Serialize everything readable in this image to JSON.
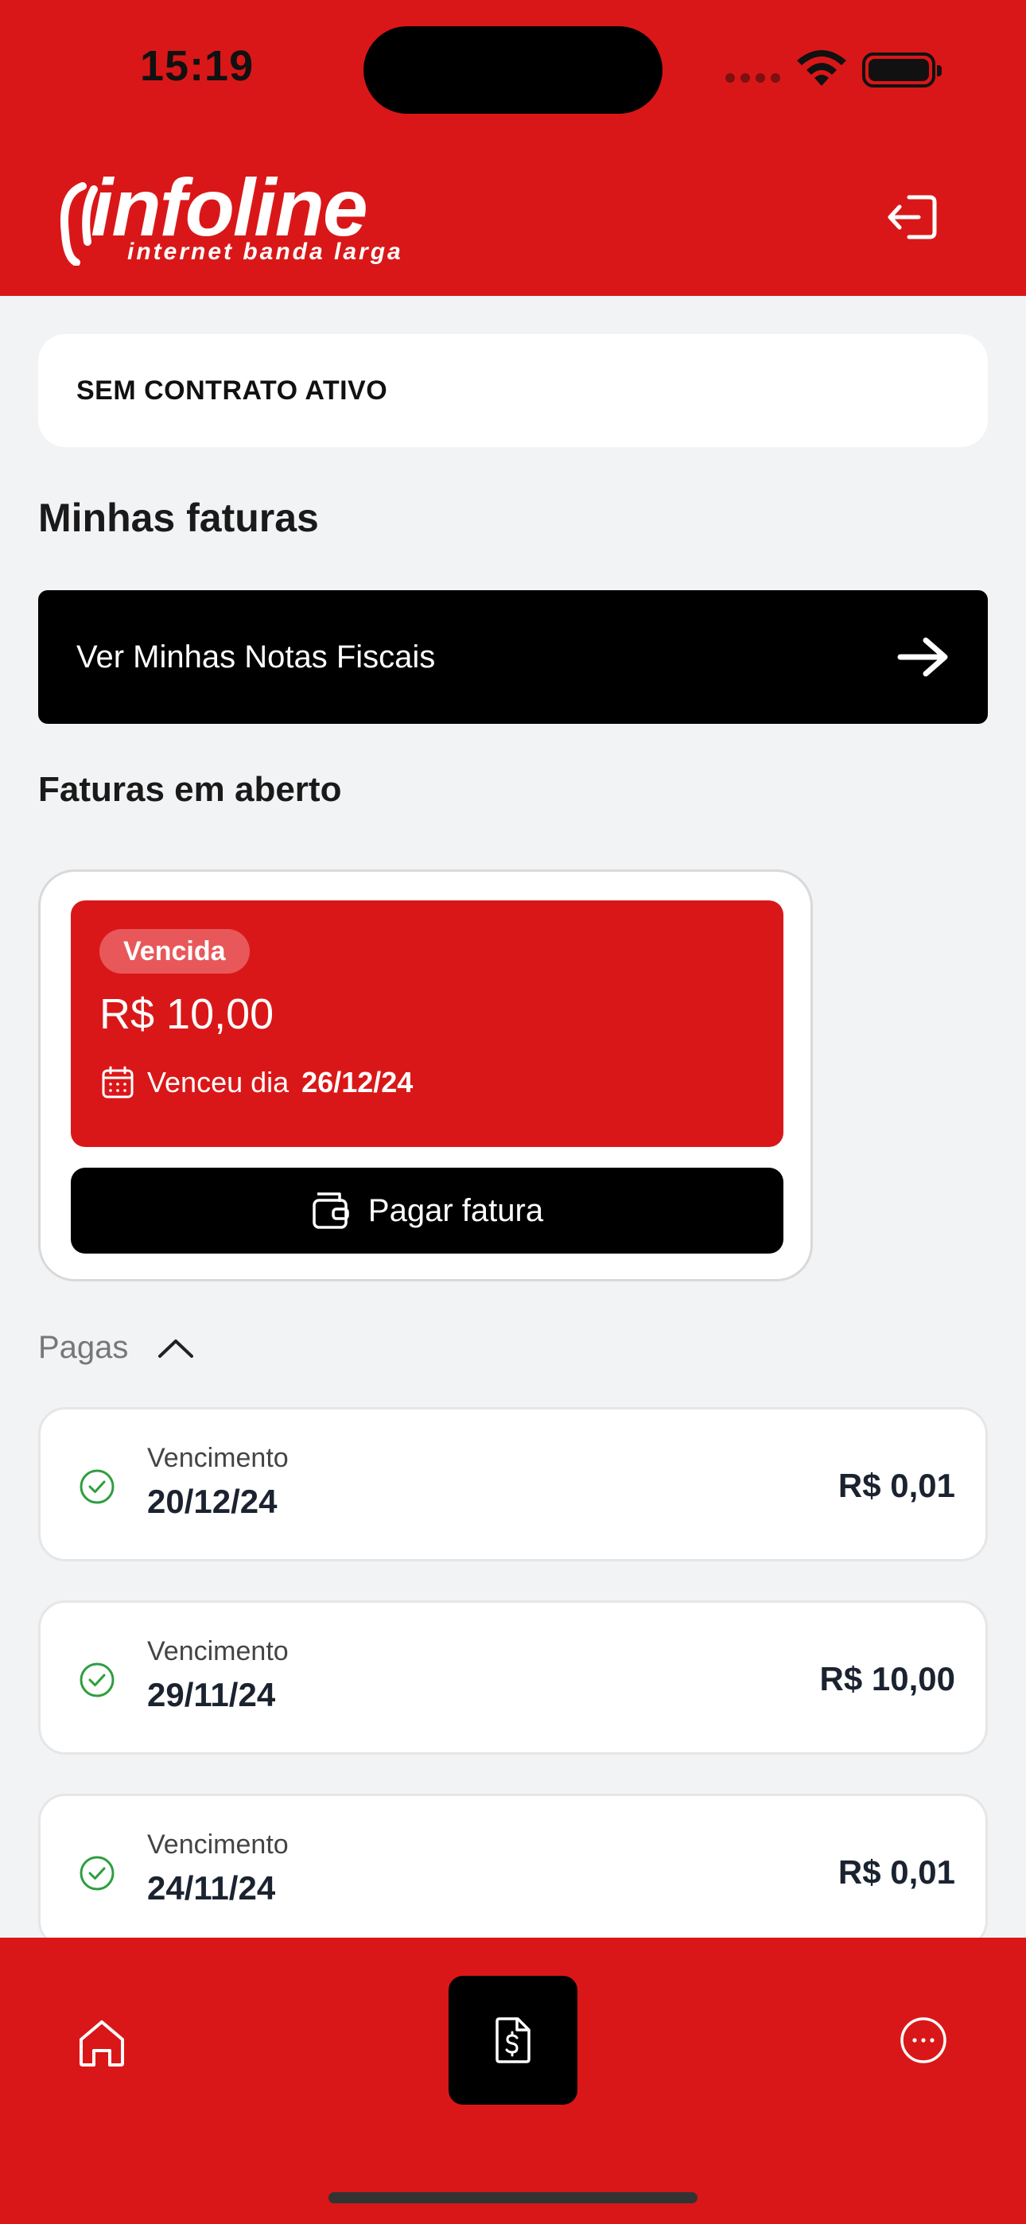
{
  "status_bar": {
    "time": "15:19"
  },
  "brand": {
    "name": "infoline",
    "tagline": "internet banda larga"
  },
  "contract": {
    "status_text": "SEM CONTRATO ATIVO"
  },
  "invoices_section": {
    "title": "Minhas faturas"
  },
  "notes_button": {
    "label": "Ver Minhas Notas Fiscais"
  },
  "open_invoices": {
    "title": "Faturas em aberto",
    "items": [
      {
        "badge": "Vencida",
        "amount": "R$ 10,00",
        "due_prefix": "Venceu dia",
        "due_date": "26/12/24",
        "pay_label": "Pagar fatura"
      }
    ]
  },
  "paid_invoices": {
    "toggle_label": "Pagas",
    "items": [
      {
        "label": "Vencimento",
        "date": "20/12/24",
        "amount": "R$ 0,01"
      },
      {
        "label": "Vencimento",
        "date": "29/11/24",
        "amount": "R$ 10,00"
      },
      {
        "label": "Vencimento",
        "date": "24/11/24",
        "amount": "R$ 0,01"
      }
    ]
  },
  "colors": {
    "brand_red": "#da1718",
    "black": "#000000",
    "paid_green": "#2e9e3f"
  },
  "icons": {
    "logout": "logout-icon",
    "arrow": "arrow-right-icon",
    "calendar": "calendar-icon",
    "wallet": "wallet-icon",
    "chevron": "chevron-up-icon",
    "check": "check-circle-icon",
    "home": "home-icon",
    "invoice": "invoice-dollar-icon",
    "more": "more-dots-icon"
  }
}
